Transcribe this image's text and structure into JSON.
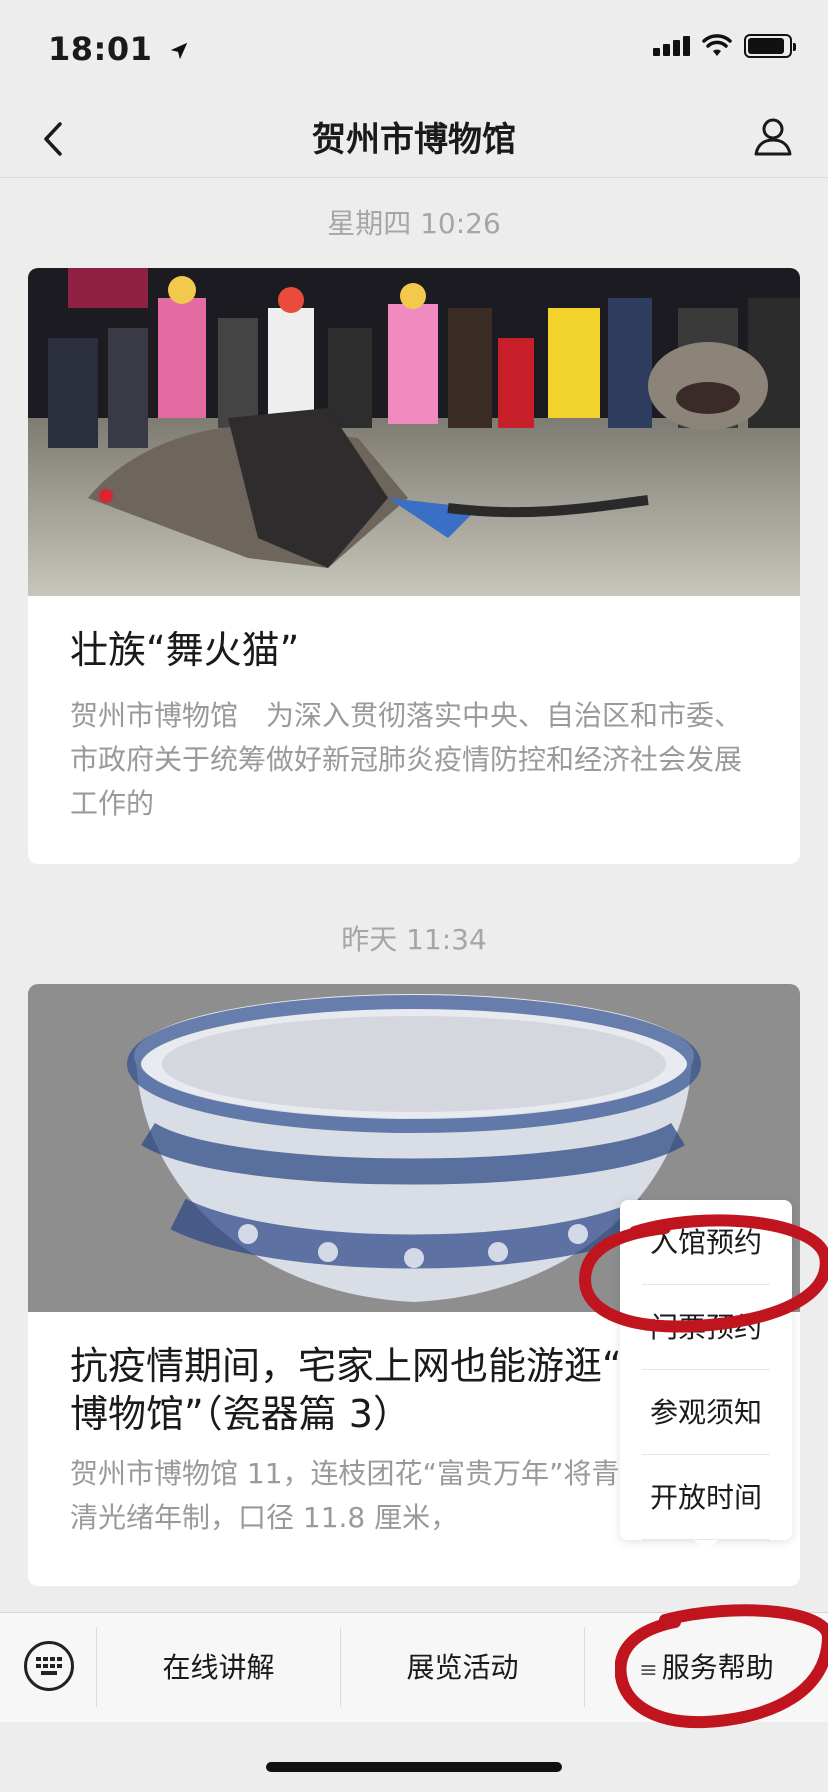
{
  "status_bar": {
    "time": "18:01",
    "icons": [
      "location-arrow-icon",
      "signal-icon",
      "wifi-icon",
      "battery-icon"
    ],
    "battery_level": 0.9
  },
  "nav": {
    "title": "贺州市博物馆",
    "back_icon": "chevron-left-icon",
    "profile_icon": "person-icon"
  },
  "feed": [
    {
      "timestamp": "星期四 10:26",
      "image": "photo-folk-performance",
      "title": "壮族“舞火猫”",
      "desc": "贺州市博物馆　为深入贯彻落实中央、自治区和市委、市政府关于统筹做好新冠肺炎疫情防控和经济社会发展工作的"
    },
    {
      "timestamp": "昨天 11:34",
      "image": "photo-blue-white-porcelain-bowl",
      "title": "抗疫情期间，宅家上网也能游逛“贺州市博物馆”（瓷器篇 3）",
      "desc": "贺州市博物馆 11，连枝团花“富贵万年”将青花瓷器，清光绪年制，口径 11.8 厘米，"
    }
  ],
  "popup_menu": {
    "items": [
      "入馆预约",
      "门票预约",
      "参观须知",
      "开放时间"
    ]
  },
  "bottom_menu": {
    "keyboard_icon": "keyboard-icon",
    "items": [
      "在线讲解",
      "展览活动",
      "服务帮助"
    ]
  },
  "colors": {
    "background": "#ededed",
    "card": "#ffffff",
    "annotation": "#c0151f"
  }
}
